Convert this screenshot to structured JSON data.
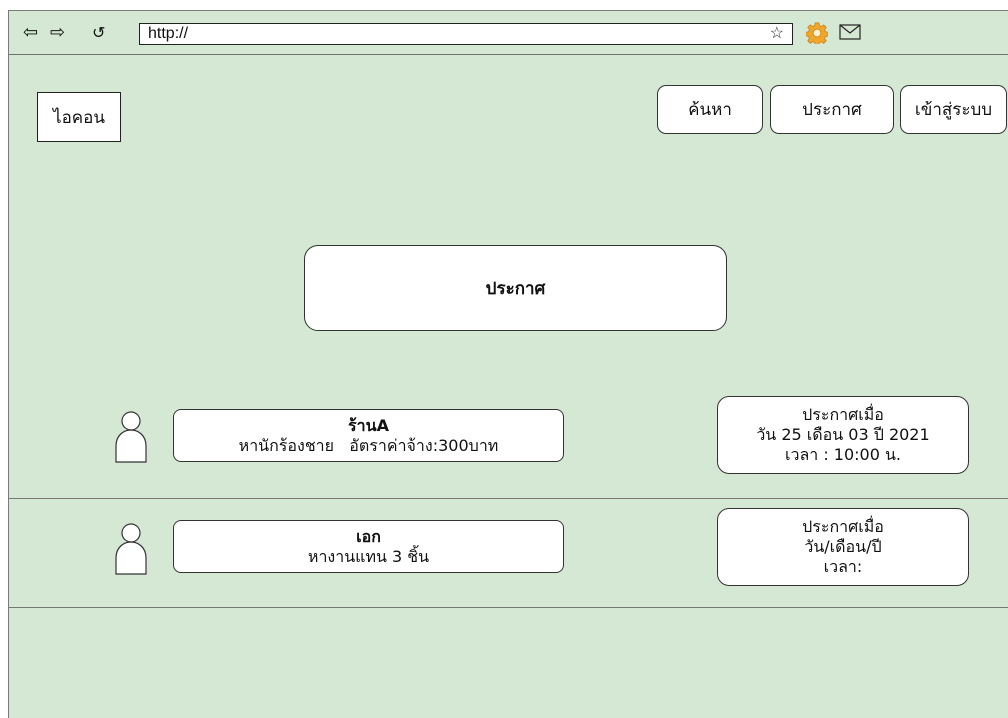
{
  "browser": {
    "back_icon": "back-arrow-icon",
    "forward_icon": "forward-arrow-icon",
    "refresh_icon": "refresh-icon",
    "address_value": "http://",
    "bookmark_icon": "star-icon",
    "settings_icon": "gear-icon",
    "mail_icon": "mail-icon"
  },
  "header": {
    "logo_label": "ไอคอน",
    "search_label": "ค้นหา",
    "announce_label": "ประกาศ",
    "login_label": "เข้าสู่ระบบ"
  },
  "main": {
    "announce_button_label": "ประกาศ"
  },
  "posts": [
    {
      "title": "ร้านA",
      "description": "หานักร้องชาย   อัตราค่าจ้าง:300บาท",
      "time_title": "ประกาศเมื่อ",
      "date_text": "วัน 25 เดือน 03 ปี 2021",
      "time_text": "เวลา : 10:00 น."
    },
    {
      "title": "เอก",
      "description": "หางานแทน 3 ชิ้น",
      "time_title": "ประกาศเมื่อ",
      "date_text": "วัน/เดือน/ปี",
      "time_text": "เวลา:"
    }
  ],
  "colors": {
    "page_background": "#d5e8d4",
    "card_background": "#ffffff",
    "border": "#333333",
    "gear_orange": "#f0a62a"
  }
}
